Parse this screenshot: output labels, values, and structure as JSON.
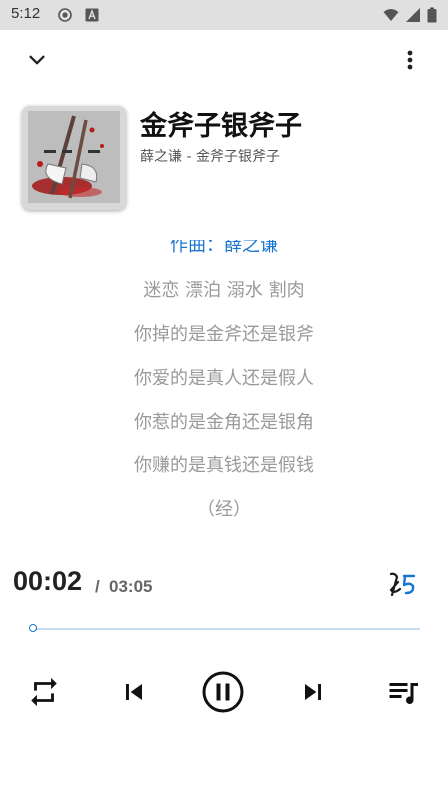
{
  "status_bar": {
    "time": "5:12"
  },
  "song": {
    "title": "金斧子银斧子",
    "subtitle": "薛之谦 - 金斧子银斧子"
  },
  "lyrics": {
    "current": "作曲：薛之谦",
    "lines": [
      "迷恋 漂泊 溺水 割肉",
      "你掉的是金斧还是银斧",
      "你爱的是真人还是假人",
      "你惹的是金角还是银角",
      "你赚的是真钱还是假钱",
      "（经）"
    ]
  },
  "playback": {
    "current_time": "00:02",
    "separator": "/",
    "total_time": "03:05",
    "progress_fraction": 0.011
  },
  "icons": {
    "collapse": "chevron-down-icon",
    "more": "more-vertical-icon",
    "lyrics_toggle": "lyrics-icon",
    "repeat": "repeat-icon",
    "previous": "skip-previous-icon",
    "pause": "pause-circle-icon",
    "next": "skip-next-icon",
    "queue": "playlist-icon"
  },
  "colors": {
    "accent": "#1976d2",
    "status_bar": "#e0e0e0",
    "lyric_text": "#9a9a9a"
  }
}
